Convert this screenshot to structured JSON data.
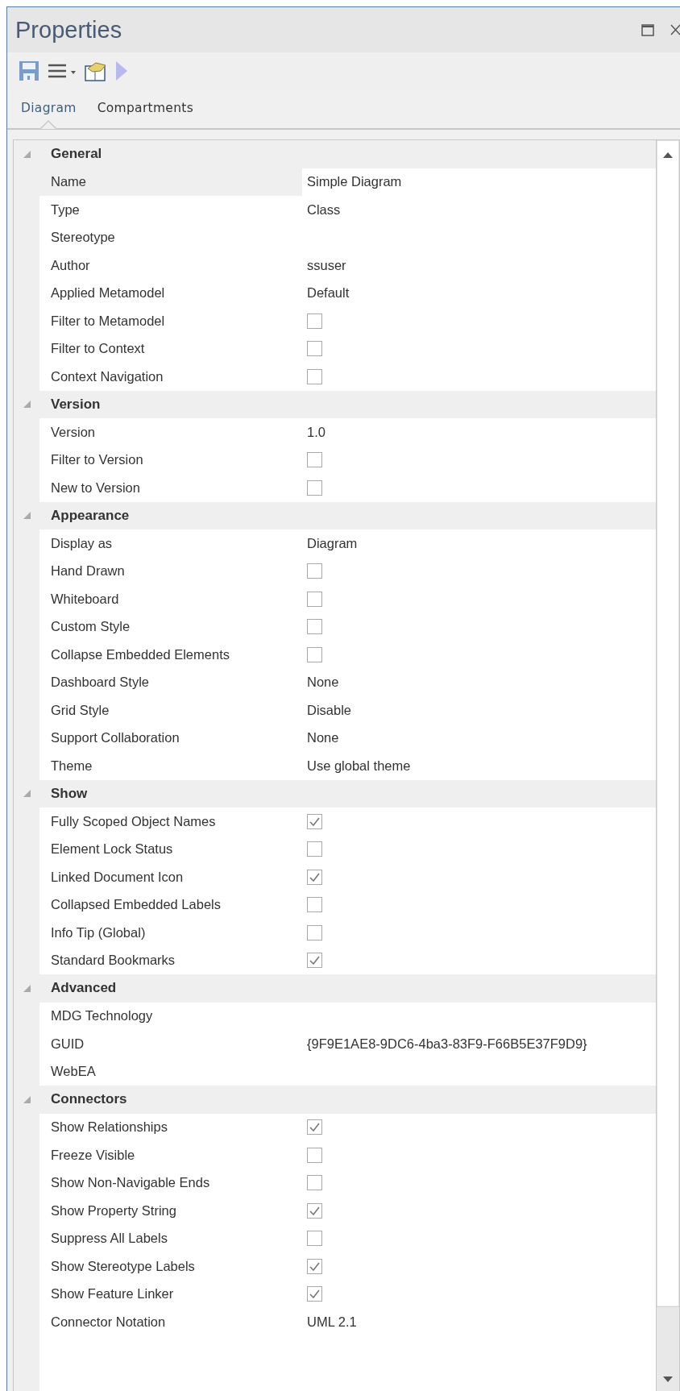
{
  "window": {
    "title": "Properties"
  },
  "tabs": [
    {
      "label": "Diagram",
      "selected": true
    },
    {
      "label": "Compartments",
      "selected": false
    }
  ],
  "sections": [
    {
      "title": "General",
      "expanded": true,
      "rows": [
        {
          "name": "Name",
          "kind": "text",
          "value": "Simple Diagram",
          "selected": true
        },
        {
          "name": "Type",
          "kind": "text",
          "value": "Class",
          "selected": false
        },
        {
          "name": "Stereotype",
          "kind": "text",
          "selected": false
        },
        {
          "name": "Author",
          "kind": "text",
          "value": "ssuser",
          "selected": false
        },
        {
          "name": "Applied Metamodel",
          "kind": "text",
          "value": "Default",
          "selected": false
        },
        {
          "name": "Filter to Metamodel",
          "kind": "checkbox",
          "checked": false,
          "selected": false
        },
        {
          "name": "Filter to Context",
          "kind": "checkbox",
          "checked": false,
          "selected": false
        },
        {
          "name": "Context Navigation",
          "kind": "checkbox",
          "checked": false,
          "selected": false
        }
      ]
    },
    {
      "title": "Version",
      "expanded": true,
      "rows": [
        {
          "name": "Version",
          "kind": "text",
          "value": "1.0",
          "selected": false
        },
        {
          "name": "Filter to Version",
          "kind": "checkbox",
          "checked": false,
          "selected": false
        },
        {
          "name": "New to Version",
          "kind": "checkbox",
          "checked": false,
          "selected": false
        }
      ]
    },
    {
      "title": "Appearance",
      "expanded": true,
      "rows": [
        {
          "name": "Display as",
          "kind": "text",
          "value": "Diagram",
          "selected": false
        },
        {
          "name": "Hand Drawn",
          "kind": "checkbox",
          "checked": false,
          "selected": false
        },
        {
          "name": "Whiteboard",
          "kind": "checkbox",
          "checked": false,
          "selected": false
        },
        {
          "name": "Custom Style",
          "kind": "checkbox",
          "checked": false,
          "selected": false
        },
        {
          "name": "Collapse Embedded Elements",
          "kind": "checkbox",
          "checked": false,
          "selected": false
        },
        {
          "name": "Dashboard Style",
          "kind": "text",
          "value": "None",
          "selected": false
        },
        {
          "name": "Grid Style",
          "kind": "text",
          "value": "Disable",
          "selected": false
        },
        {
          "name": "Support Collaboration",
          "kind": "text",
          "value": "None",
          "selected": false
        },
        {
          "name": "Theme",
          "kind": "text",
          "value": "Use global theme",
          "selected": false
        }
      ]
    },
    {
      "title": "Show",
      "expanded": true,
      "rows": [
        {
          "name": "Fully Scoped Object Names",
          "kind": "checkbox",
          "checked": true,
          "selected": false
        },
        {
          "name": "Element Lock Status",
          "kind": "checkbox",
          "checked": false,
          "selected": false
        },
        {
          "name": "Linked Document Icon",
          "kind": "checkbox",
          "checked": true,
          "selected": false
        },
        {
          "name": "Collapsed Embedded Labels",
          "kind": "checkbox",
          "checked": false,
          "selected": false
        },
        {
          "name": "Info Tip (Global)",
          "kind": "checkbox",
          "checked": false,
          "selected": false
        },
        {
          "name": "Standard Bookmarks",
          "kind": "checkbox",
          "checked": true,
          "selected": false
        }
      ]
    },
    {
      "title": "Advanced",
      "expanded": true,
      "rows": [
        {
          "name": "MDG Technology",
          "kind": "text",
          "selected": false
        },
        {
          "name": "GUID",
          "kind": "text",
          "value": "{9F9E1AE8-9DC6-4ba3-83F9-F66B5E37F9D9}",
          "selected": false
        },
        {
          "name": "WebEA",
          "kind": "text",
          "selected": false
        }
      ]
    },
    {
      "title": "Connectors",
      "expanded": true,
      "rows": [
        {
          "name": "Show Relationships",
          "kind": "checkbox",
          "checked": true,
          "selected": false
        },
        {
          "name": "Freeze Visible",
          "kind": "checkbox",
          "checked": false,
          "selected": false
        },
        {
          "name": "Show Non-Navigable Ends",
          "kind": "checkbox",
          "checked": false,
          "selected": false
        },
        {
          "name": "Show Property String",
          "kind": "checkbox",
          "checked": true,
          "selected": false
        },
        {
          "name": "Suppress All Labels",
          "kind": "checkbox",
          "checked": false,
          "selected": false
        },
        {
          "name": "Show Stereotype Labels",
          "kind": "checkbox",
          "checked": true,
          "selected": false
        },
        {
          "name": "Show Feature Linker",
          "kind": "checkbox",
          "checked": true,
          "selected": false
        },
        {
          "name": "Connector Notation",
          "kind": "text",
          "value": "UML 2.1",
          "selected": false
        }
      ]
    }
  ]
}
